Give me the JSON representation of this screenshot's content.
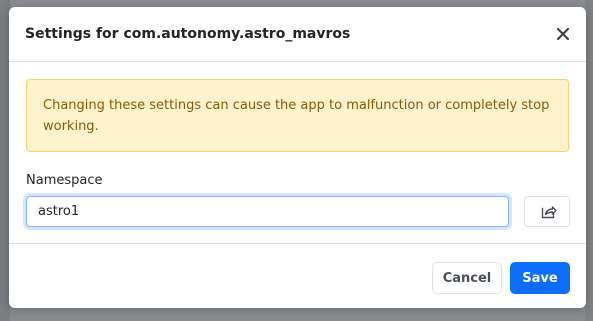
{
  "modal": {
    "title": "Settings for com.autonomy.astro_mavros",
    "close_icon": "close-icon"
  },
  "alert": {
    "message": "Changing these settings can cause the app to malfunction or completely stop working.",
    "color": "#fff3cd"
  },
  "namespace": {
    "label": "Namespace",
    "value": "astro1",
    "share_icon": "share-icon"
  },
  "footer": {
    "cancel_label": "Cancel",
    "save_label": "Save",
    "primary_color": "#0d6efd"
  }
}
